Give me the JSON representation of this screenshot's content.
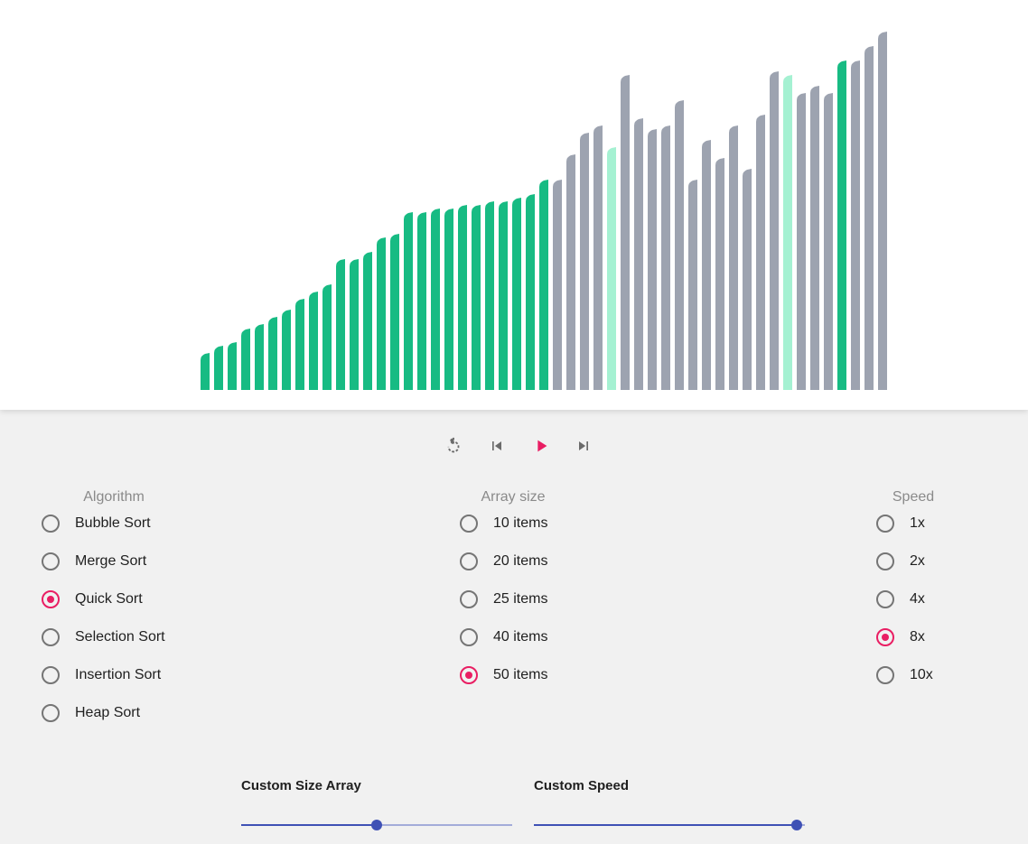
{
  "visualizer": {
    "colors": {
      "sorted": "#17bb83",
      "unsorted": "#9da3b0",
      "active": "#a5f1d2"
    },
    "bars": [
      {
        "value": 40,
        "state": "sorted"
      },
      {
        "value": 48,
        "state": "sorted"
      },
      {
        "value": 52,
        "state": "sorted"
      },
      {
        "value": 67,
        "state": "sorted"
      },
      {
        "value": 72,
        "state": "sorted"
      },
      {
        "value": 80,
        "state": "sorted"
      },
      {
        "value": 88,
        "state": "sorted"
      },
      {
        "value": 100,
        "state": "sorted"
      },
      {
        "value": 108,
        "state": "sorted"
      },
      {
        "value": 116,
        "state": "sorted"
      },
      {
        "value": 144,
        "state": "sorted"
      },
      {
        "value": 144,
        "state": "sorted"
      },
      {
        "value": 152,
        "state": "sorted"
      },
      {
        "value": 168,
        "state": "sorted"
      },
      {
        "value": 172,
        "state": "sorted"
      },
      {
        "value": 196,
        "state": "sorted"
      },
      {
        "value": 196,
        "state": "sorted"
      },
      {
        "value": 200,
        "state": "sorted"
      },
      {
        "value": 200,
        "state": "sorted"
      },
      {
        "value": 204,
        "state": "sorted"
      },
      {
        "value": 204,
        "state": "sorted"
      },
      {
        "value": 208,
        "state": "sorted"
      },
      {
        "value": 208,
        "state": "sorted"
      },
      {
        "value": 212,
        "state": "sorted"
      },
      {
        "value": 216,
        "state": "sorted"
      },
      {
        "value": 232,
        "state": "sorted"
      },
      {
        "value": 232,
        "state": "unsorted"
      },
      {
        "value": 260,
        "state": "unsorted"
      },
      {
        "value": 284,
        "state": "unsorted"
      },
      {
        "value": 292,
        "state": "unsorted"
      },
      {
        "value": 268,
        "state": "active"
      },
      {
        "value": 348,
        "state": "unsorted"
      },
      {
        "value": 300,
        "state": "unsorted"
      },
      {
        "value": 288,
        "state": "unsorted"
      },
      {
        "value": 292,
        "state": "unsorted"
      },
      {
        "value": 320,
        "state": "unsorted"
      },
      {
        "value": 232,
        "state": "unsorted"
      },
      {
        "value": 276,
        "state": "unsorted"
      },
      {
        "value": 256,
        "state": "unsorted"
      },
      {
        "value": 292,
        "state": "unsorted"
      },
      {
        "value": 244,
        "state": "unsorted"
      },
      {
        "value": 304,
        "state": "unsorted"
      },
      {
        "value": 352,
        "state": "unsorted"
      },
      {
        "value": 348,
        "state": "active"
      },
      {
        "value": 328,
        "state": "unsorted"
      },
      {
        "value": 336,
        "state": "unsorted"
      },
      {
        "value": 328,
        "state": "unsorted"
      },
      {
        "value": 364,
        "state": "sorted"
      },
      {
        "value": 364,
        "state": "unsorted"
      },
      {
        "value": 380,
        "state": "unsorted"
      },
      {
        "value": 396,
        "state": "unsorted"
      }
    ]
  },
  "controls": {
    "reset_icon": "replay-icon",
    "prev_icon": "skip-previous-icon",
    "play_icon": "play-icon",
    "next_icon": "skip-next-icon",
    "accent": "#e91e63",
    "icon_color": "#6b6b6b"
  },
  "algorithm": {
    "title": "Algorithm",
    "options": [
      {
        "label": "Bubble Sort",
        "checked": false
      },
      {
        "label": "Merge Sort",
        "checked": false
      },
      {
        "label": "Quick Sort",
        "checked": true
      },
      {
        "label": "Selection Sort",
        "checked": false
      },
      {
        "label": "Insertion Sort",
        "checked": false
      },
      {
        "label": "Heap Sort",
        "checked": false
      }
    ]
  },
  "array_size": {
    "title": "Array size",
    "options": [
      {
        "label": "10 items",
        "checked": false
      },
      {
        "label": "20 items",
        "checked": false
      },
      {
        "label": "25 items",
        "checked": false
      },
      {
        "label": "40 items",
        "checked": false
      },
      {
        "label": "50 items",
        "checked": true
      }
    ]
  },
  "speed": {
    "title": "Speed",
    "options": [
      {
        "label": "1x",
        "checked": false
      },
      {
        "label": "2x",
        "checked": false
      },
      {
        "label": "4x",
        "checked": false
      },
      {
        "label": "8x",
        "checked": true
      },
      {
        "label": "10x",
        "checked": false
      }
    ]
  },
  "custom_size": {
    "title": "Custom Size Array",
    "fraction": 0.5
  },
  "custom_speed": {
    "title": "Custom Speed",
    "fraction": 0.97
  },
  "slider_colors": {
    "active": "#3f51b5",
    "inactive": "#a3acd9"
  }
}
